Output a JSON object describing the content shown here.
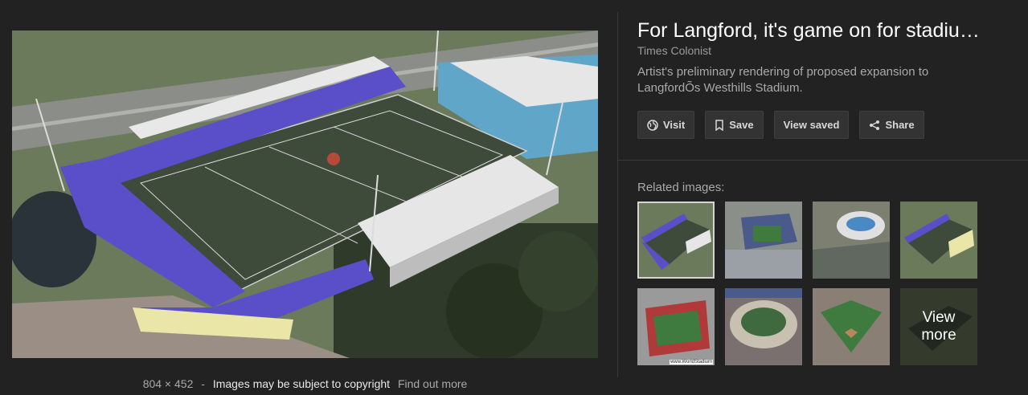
{
  "preview": {
    "alt": "Aerial rendering of stadium expansion",
    "dimensions": "804 × 452",
    "separator": "-",
    "copyright_notice": "Images may be subject to copyright",
    "find_out_more": "Find out more"
  },
  "panel": {
    "title": "For Langford, it's game on for stadiu…",
    "source": "Times Colonist",
    "description": "Artist's preliminary rendering of proposed expansion to LangfordÕs Westhills Stadium."
  },
  "buttons": {
    "visit": "Visit",
    "save": "Save",
    "view_saved": "View saved",
    "share": "Share"
  },
  "related": {
    "label": "Related images:",
    "view_more_line1": "View",
    "view_more_line2": "more",
    "watermark": "www.WorldStadium"
  },
  "colors": {
    "background": "#222222",
    "seats": "#5a4fc8",
    "field": "#3e4a3a"
  }
}
